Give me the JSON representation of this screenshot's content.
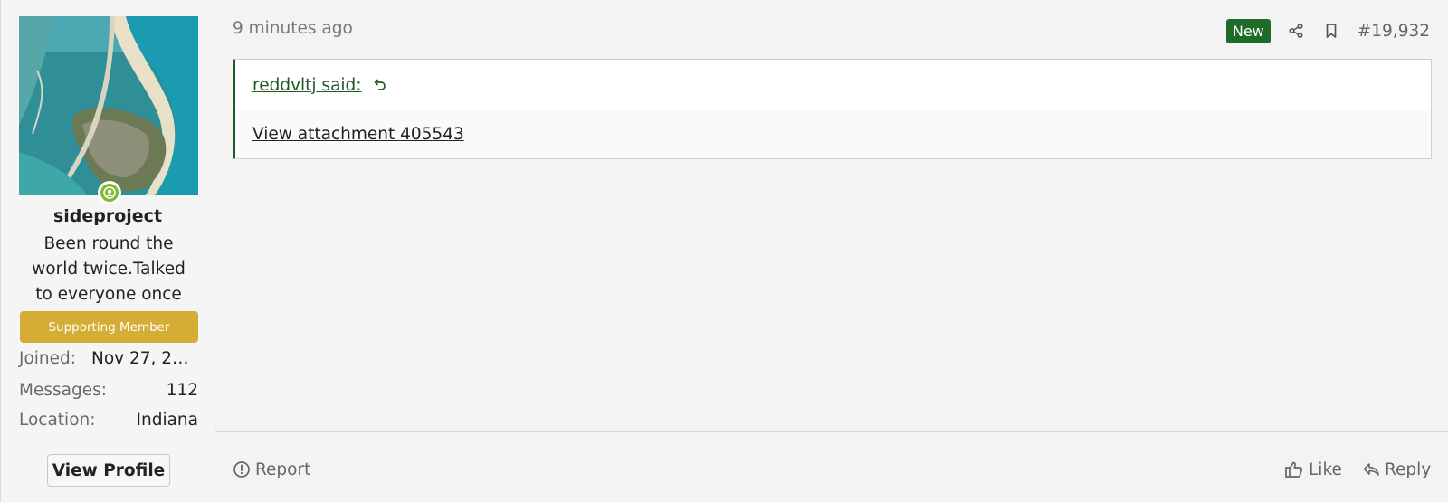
{
  "user": {
    "username": "sideproject",
    "title": "Been round the world twice.Talked to everyone once",
    "banner": "Supporting Member",
    "stats": [
      {
        "key": "Joined:",
        "value": "Nov 27, 20..."
      },
      {
        "key": "Messages:",
        "value": "112"
      },
      {
        "key": "Location:",
        "value": "Indiana"
      }
    ],
    "view_profile_label": "View Profile"
  },
  "post": {
    "time": "9 minutes ago",
    "new_label": "New",
    "number": "#19,932",
    "quote": {
      "author_link": "reddvltj said:",
      "body_link": "View attachment 405543"
    },
    "actions": {
      "report": "Report",
      "like": "Like",
      "reply": "Reply"
    }
  },
  "icons": {
    "online": "user-circle-icon",
    "share": "share-icon",
    "bookmark": "bookmark-icon",
    "jump": "arrow-up-back-icon",
    "report": "exclamation-circle-icon",
    "like": "thumbs-up-icon",
    "reply": "reply-arrow-icon"
  },
  "colors": {
    "accent_green": "#1e5a26",
    "new_badge": "#1e6b2a",
    "online": "#7fba2a",
    "supporting_banner": "#d4ad35"
  }
}
